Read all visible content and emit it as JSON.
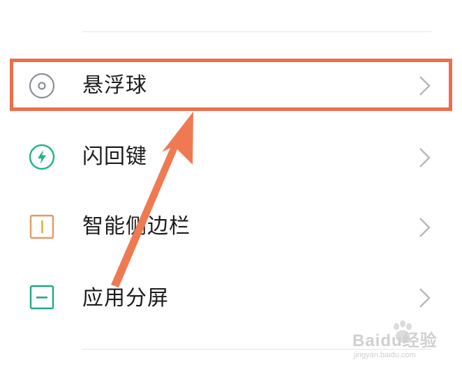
{
  "settings_list": {
    "items": [
      {
        "label": "悬浮球",
        "icon": "floating-ball-icon",
        "icon_color": "#8a8f99"
      },
      {
        "label": "闪回键",
        "icon": "lightning-icon",
        "icon_color": "#23b38a"
      },
      {
        "label": "智能侧边栏",
        "icon": "sidebar-icon",
        "icon_color": "#e09a6a"
      },
      {
        "label": "应用分屏",
        "icon": "split-screen-icon",
        "icon_color": "#1fa88a"
      }
    ],
    "chevron_icon": "chevron-right-icon"
  },
  "annotation": {
    "highlight_color": "#ef6d4a",
    "arrow_color": "#ef7a52",
    "highlighted_item": "悬浮球"
  },
  "watermark": {
    "brand": "Baidu经验",
    "url": "jingyan.baidu.com"
  }
}
